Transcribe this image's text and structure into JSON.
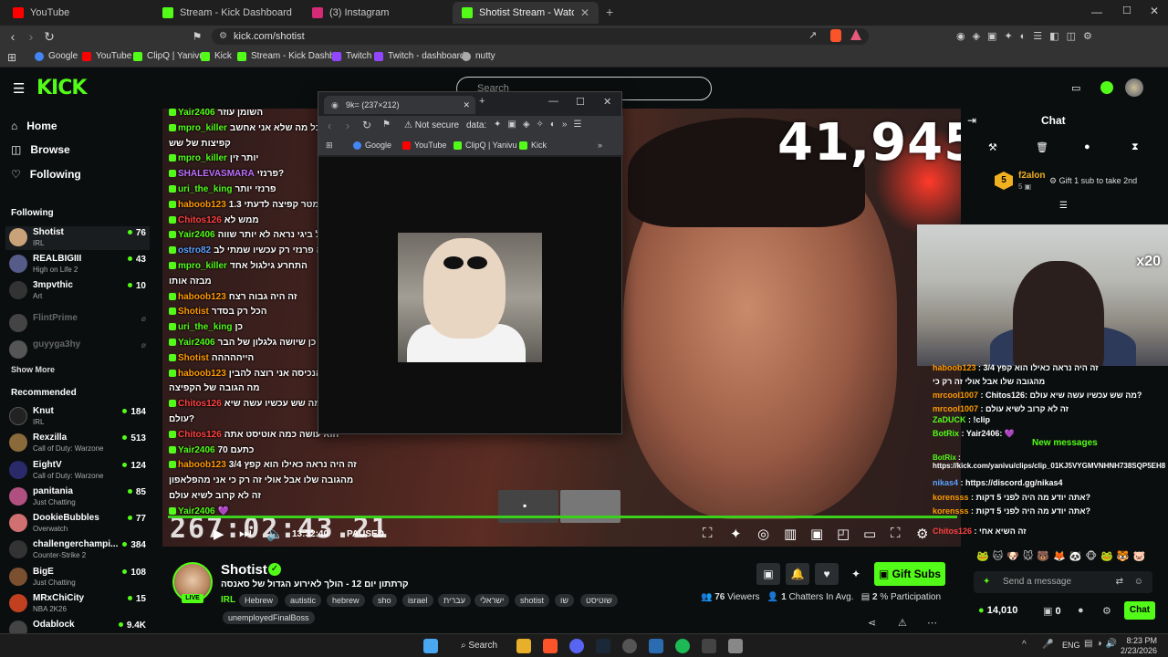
{
  "browser": {
    "tabs": [
      {
        "label": "YouTube",
        "color": "#ff0000"
      },
      {
        "label": "Stream - Kick Dashboard",
        "color": "#53fc18"
      },
      {
        "label": "(3) Instagram",
        "color": "#d62976"
      },
      {
        "label": "Shotist Stream - Watch Live on K",
        "color": "#53fc18"
      }
    ],
    "url": "kick.com/shotist",
    "bookmarks": [
      "Google",
      "YouTube",
      "ClipQ | Yanivu",
      "Kick",
      "Stream - Kick Dashb...",
      "Twitch",
      "Twitch - dashboard",
      "nutty"
    ]
  },
  "header": {
    "logo": "KICK",
    "search_placeholder": "Search"
  },
  "sidebar": {
    "nav": [
      "Home",
      "Browse",
      "Following"
    ],
    "following_title": "Following",
    "following": [
      {
        "name": "Shotist",
        "cat": "IRL",
        "viewers": "76",
        "color": "#caa27a"
      },
      {
        "name": "REALBIGIII",
        "cat": "High on Life 2",
        "viewers": "43",
        "color": "#555c8a"
      },
      {
        "name": "3mpvthic",
        "cat": "Art",
        "viewers": "10",
        "color": "#333"
      },
      {
        "name": "FlintPrime",
        "cat": "",
        "viewers": "",
        "color": "#444"
      },
      {
        "name": "guyyga3hy",
        "cat": "",
        "viewers": "",
        "color": "#555"
      }
    ],
    "show_more": "Show More",
    "recommended_title": "Recommended",
    "recommended": [
      {
        "name": "Knut",
        "cat": "IRL",
        "viewers": "184",
        "color": "#222"
      },
      {
        "name": "Rexzilla",
        "cat": "Call of Duty: Warzone",
        "viewers": "513",
        "color": "#8a6a3a"
      },
      {
        "name": "EightV",
        "cat": "Call of Duty: Warzone",
        "viewers": "124",
        "color": "#2a2a6a"
      },
      {
        "name": "panitania",
        "cat": "Just Chatting",
        "viewers": "85",
        "color": "#b05080"
      },
      {
        "name": "DookieBubbles",
        "cat": "Overwatch",
        "viewers": "77",
        "color": "#d07070"
      },
      {
        "name": "challengerchampi...",
        "cat": "Counter-Strike 2",
        "viewers": "384",
        "color": "#333"
      },
      {
        "name": "BigE",
        "cat": "Just Chatting",
        "viewers": "108",
        "color": "#7a5030"
      },
      {
        "name": "MRxChiCity",
        "cat": "NBA 2K26",
        "viewers": "15",
        "color": "#c04020"
      },
      {
        "name": "Odablock",
        "cat": "",
        "viewers": "9.4K",
        "color": "#444"
      }
    ]
  },
  "video": {
    "counter": "41,945",
    "timer": "267:02:43.21",
    "clip_time": "13:32:40",
    "state": "PAUSED",
    "overlay_chat": [
      {
        "user": "Yair2406",
        "text": "השומן עוזר",
        "color": "#53fc18"
      },
      {
        "user": "mpro_killer",
        "text": "כל מה שלא אני אחשב",
        "color": "#53fc18"
      },
      {
        "user": "",
        "text": "קפיצות של שש",
        "color": "#fff"
      },
      {
        "user": "mpro_killer",
        "text": "יותר זין",
        "color": "#53fc18"
      },
      {
        "user": "SHALEVASMARA",
        "text": "פרנזי?",
        "color": "#c070ff"
      },
      {
        "user": "uri_the_king",
        "text": "פרנזי יותר",
        "color": "#53fc18"
      },
      {
        "user": "haboob123",
        "text": "1.3 מטר קפיצה לדעתי",
        "color": "#ff9a00"
      },
      {
        "user": "Chitos126",
        "text": "ממש לא",
        "color": "#ff4040"
      },
      {
        "user": "Yair2406",
        "text": "וול ביגי נראה לא יותר שווה",
        "color": "#53fc18"
      },
      {
        "user": "ostro82",
        "text": "זה פרנזי רק עכשיו שמתי לב",
        "color": "#5aa0ff"
      },
      {
        "user": "mpro_killer",
        "text": "התחרע גילגול אחד",
        "color": "#53fc18"
      },
      {
        "user": "",
        "text": "מבזה אותו",
        "color": "#fff"
      },
      {
        "user": "haboob123",
        "text": "זה היה גבוה רצח",
        "color": "#ff9a00"
      },
      {
        "user": "Shotist",
        "text": "הכל רק בסדר",
        "color": "#ff9a00"
      },
      {
        "user": "uri_the_king",
        "text": "כן",
        "color": "#53fc18"
      },
      {
        "user": "Yair2406",
        "text": "כן שיושה גלגלון של הבר",
        "color": "#53fc18"
      },
      {
        "user": "Shotist",
        "text": "הייההההה",
        "color": "#ff9a00"
      },
      {
        "user": "haboob123",
        "text": "אני חייב הנכיסה אני רוצה להבין",
        "color": "#ff9a00"
      },
      {
        "user": "",
        "text": "מה הגובה של הקפיצה",
        "color": "#fff"
      },
      {
        "user": "Chitos126",
        "text": "מה שש עכשיו עשה שיא",
        "color": "#ff4040"
      },
      {
        "user": "",
        "text": "עולם?",
        "color": "#fff"
      },
      {
        "user": "Chitos126",
        "text": "הוא עושה כמה אוטיסט אתה",
        "color": "#ff4040"
      },
      {
        "user": "Yair2406",
        "text": "כתעם 70",
        "color": "#53fc18"
      },
      {
        "user": "haboob123",
        "text": "זה היה נראה כאילו הוא קפץ 3/4",
        "color": "#ff9a00"
      },
      {
        "user": "",
        "text": "מהגובה שלו אבל אולי זה רק כי אני מהפלאפון",
        "color": "#fff"
      },
      {
        "user": "",
        "text": "זה לא קרוב לשיא עולם",
        "color": "#fff"
      },
      {
        "user": "Yair2406",
        "text": "💜",
        "color": "#53fc18"
      }
    ]
  },
  "popup": {
    "tab_title": "9k= (237×212)",
    "address_prefix": "Not secure",
    "address": "data:",
    "bookmarks": [
      "Google",
      "YouTube",
      "ClipQ | Yanivu",
      "Kick"
    ]
  },
  "chat": {
    "title": "Chat",
    "pinned_user": "f2alon",
    "pinned_level": "5",
    "pinned_text": "Gift 1 sub to take 2nd",
    "webcam_badge": "x20",
    "messages": [
      {
        "user": "haboob123",
        "text": "זה היה נראה כאילו הוא קפץ 3/4",
        "color": "#ff9a00"
      },
      {
        "user": "",
        "text": "מהגובה שלו אבל אולי זה רק כי",
        "color": "#fff"
      },
      {
        "user": "mrcool1007",
        "text": "Chitos126: מה שש עכשיו עשה שיא עולם?",
        "color": "#ff9a00"
      },
      {
        "user": "mrcool1007",
        "text": "זה לא קרוב לשיא עולם",
        "color": "#ff9a00"
      },
      {
        "user": "ZaDUCK",
        "text": "!clip",
        "color": "#53fc18"
      },
      {
        "user": "BotRix",
        "text": "Yair2406: 💜",
        "color": "#53fc18"
      },
      {
        "user": "BotRix",
        "text": "https://kick.com/yanivu/clips/clip_01KJ5VYGMVNHNH738SQP5EH82R",
        "color": "#53fc18"
      },
      {
        "user": "nikas4",
        "text": "https://discord.gg/nikas4",
        "color": "#5aa0ff"
      },
      {
        "user": "korensss",
        "text": "אתה יודע מה היה לפני 5 דקות?",
        "color": "#ff9a00"
      },
      {
        "user": "korensss",
        "text": "אתה יודע מה היה לפני 5 דקות?",
        "color": "#ff9a00"
      },
      {
        "user": "Chitos126",
        "text": "זה השיא אחי",
        "color": "#ff4040"
      }
    ],
    "new_messages": "New messages",
    "send_placeholder": "Send a message",
    "points": "14,010",
    "zero": "0",
    "chat_button": "Chat"
  },
  "stream_info": {
    "name": "Shotist",
    "live": "LIVE",
    "title": "קרתתון יום 12 - הולך לאירוע הגדול של סאנסה",
    "category": "IRL",
    "tags": [
      "Hebrew",
      "autistic",
      "hebrew",
      "sho",
      "israel",
      "עברית",
      "ישראלי",
      "shotist",
      "שו",
      "שוטיסט",
      "unemployedFinalBoss"
    ],
    "viewers_count": "76",
    "viewers_label": "Viewers",
    "chatters_count": "1",
    "chatters_label": "Chatters In Avg.",
    "participation_count": "2",
    "participation_label": "% Participation",
    "gift_subs": "Gift Subs"
  },
  "taskbar": {
    "search": "Search",
    "lang": "ENG",
    "time": "8:23 PM",
    "date": "2/23/2026"
  }
}
